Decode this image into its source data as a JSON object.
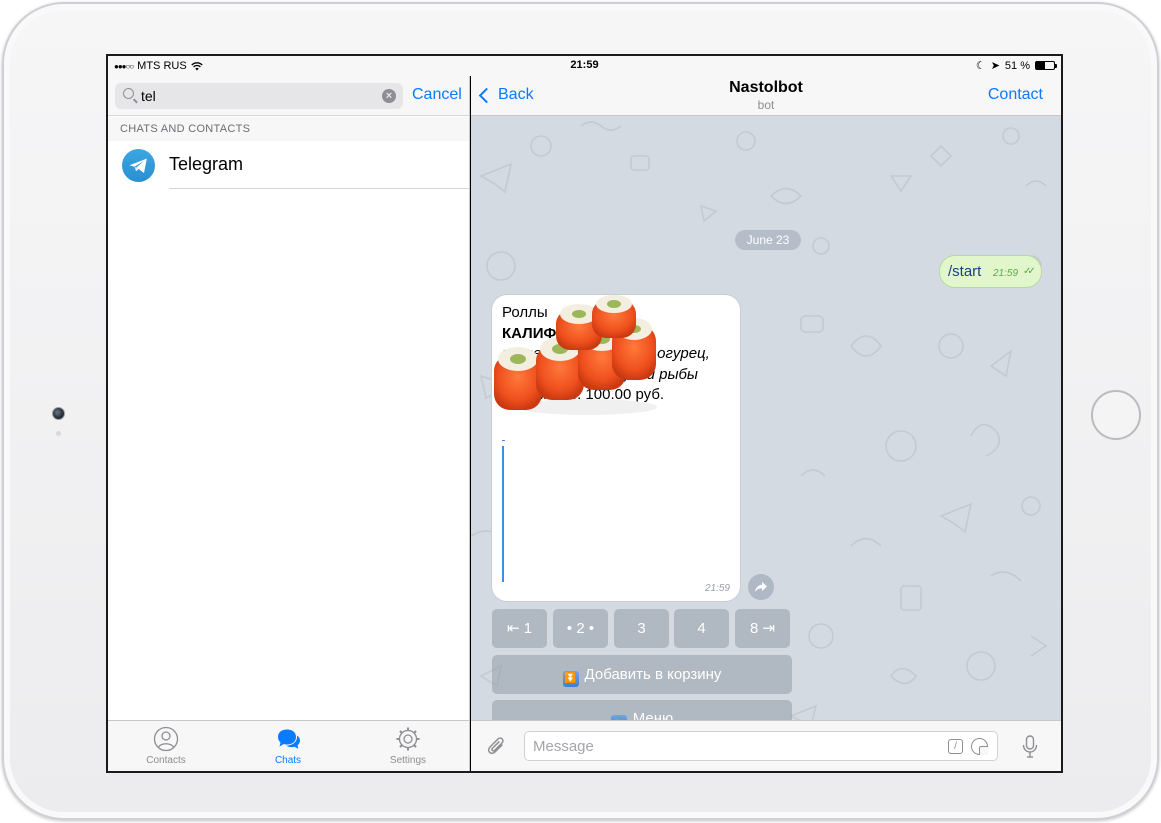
{
  "status_bar": {
    "carrier": "MTS RUS",
    "time": "21:59",
    "battery": "51 %",
    "battery_level": 0.51
  },
  "left_panel": {
    "search": {
      "value": "tel",
      "placeholder": ""
    },
    "cancel_label": "Cancel",
    "section_header": "CHATS AND CONTACTS",
    "results": [
      {
        "name": "Telegram",
        "avatar": "telegram-logo-icon"
      }
    ],
    "tabs": [
      {
        "label": "Contacts",
        "icon": "contacts-icon",
        "active": false
      },
      {
        "label": "Chats",
        "icon": "chats-icon",
        "active": true
      },
      {
        "label": "Settings",
        "icon": "settings-icon",
        "active": false
      }
    ]
  },
  "chat": {
    "back_label": "Back",
    "title": "Nastolbot",
    "subtitle": "bot",
    "contact_label": "Contact",
    "date_label": "June 23",
    "outgoing": {
      "text": "/start",
      "time": "21:59",
      "status_icon": "double-check-icon"
    },
    "incoming": {
      "line1": "Роллы",
      "line2": "КАЛИФОРНИЯ",
      "line3": "креветка, краб-крем, огурец,",
      "line4": "омлет, икра летучей рыбы",
      "line5": "Стоимость: 100.00 руб.",
      "image": "sushi-rolls-image",
      "time": "21:59"
    },
    "keyboard": {
      "row1": [
        "⇤ 1",
        "• 2 •",
        "3",
        "4",
        "8 ⇥"
      ],
      "add_to_cart": "Добавить в корзину",
      "add_icon": "⏬",
      "menu": "Меню",
      "menu_icon": "⬅"
    },
    "input": {
      "placeholder": "Message",
      "value": ""
    }
  },
  "colors": {
    "accent": "#0a7aff",
    "chat_background": "#d4dae1",
    "outgoing_bubble": "#e1f7cb",
    "telegram_blue": "#2a9ee0"
  }
}
